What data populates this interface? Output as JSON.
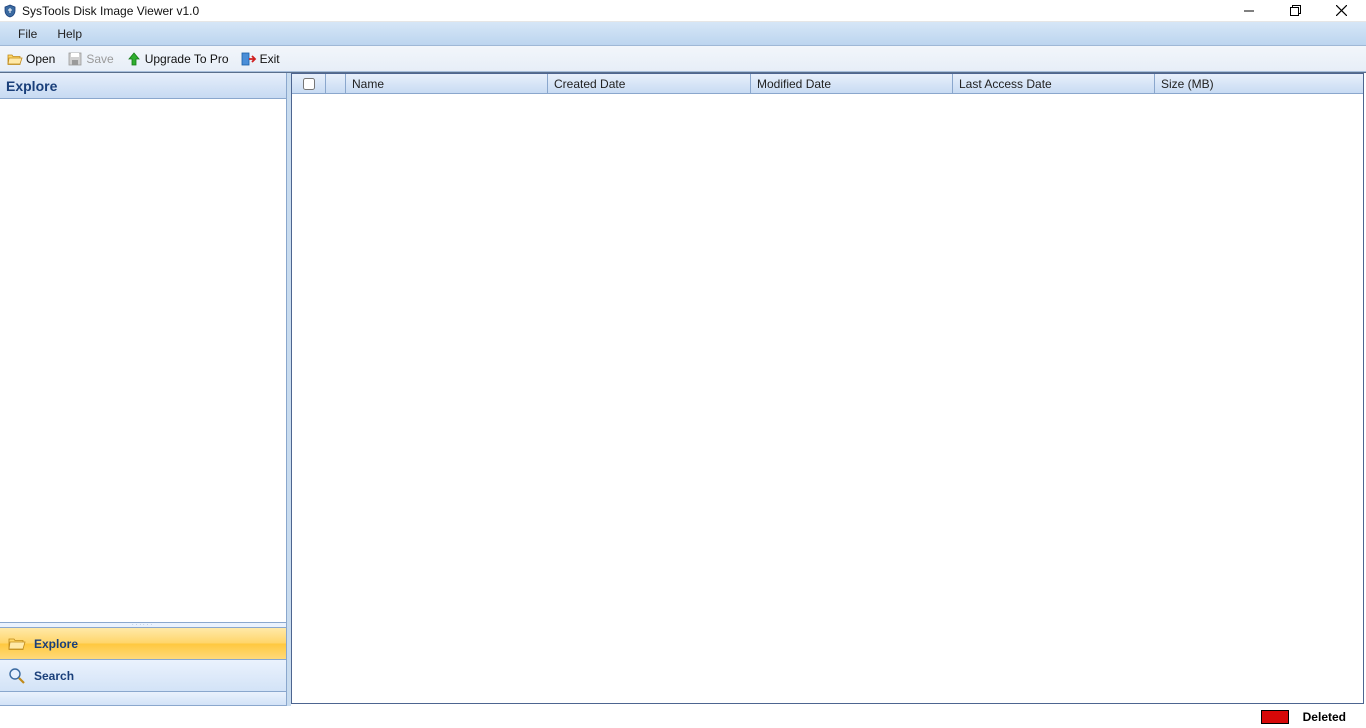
{
  "titlebar": {
    "title": "SysTools Disk Image Viewer v1.0"
  },
  "menubar": {
    "items": [
      "File",
      "Help"
    ]
  },
  "toolbar": {
    "open_label": "Open",
    "save_label": "Save",
    "upgrade_label": "Upgrade To Pro",
    "exit_label": "Exit"
  },
  "left_panel": {
    "header": "Explore",
    "nav": {
      "explore": "Explore",
      "search": "Search"
    }
  },
  "table": {
    "columns": {
      "name": "Name",
      "created": "Created Date",
      "modified": "Modified Date",
      "access": "Last Access Date",
      "size": "Size (MB)"
    }
  },
  "statusbar": {
    "legend_color": "#d70808",
    "legend_label": "Deleted"
  }
}
